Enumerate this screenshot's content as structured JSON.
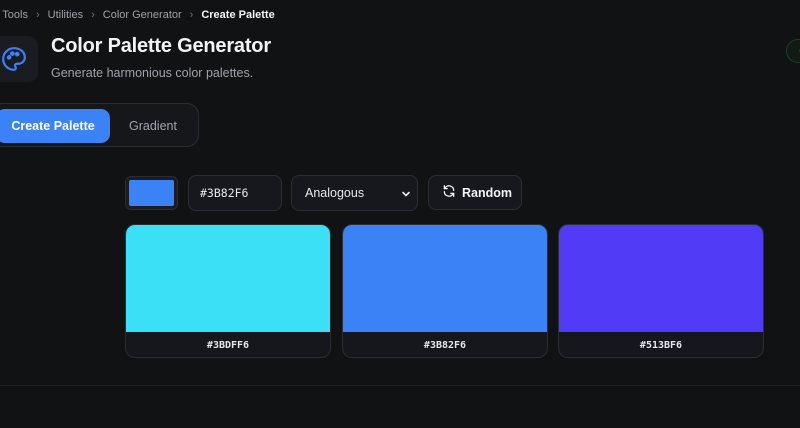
{
  "breadcrumb": {
    "items": [
      "l Tools",
      "Utilities",
      "Color Generator"
    ],
    "current": "Create Palette"
  },
  "header": {
    "icon": "palette-icon",
    "title": "Color Palette Generator",
    "subtitle": "Generate harmonious color palettes."
  },
  "tabs": [
    {
      "label": "Create Palette",
      "active": true
    },
    {
      "label": "Gradient",
      "active": false
    }
  ],
  "controls": {
    "base_color": "#3B82F6",
    "hex_value": "#3B82F6",
    "scheme": "Analogous",
    "random_label": "Random",
    "random_icon": "refresh-icon"
  },
  "palette": [
    {
      "hex": "#3BDFF6",
      "color": "#3BDFF6"
    },
    {
      "hex": "#3B82F6",
      "color": "#3B82F6"
    },
    {
      "hex": "#513BF6",
      "color": "#513BF6"
    }
  ],
  "colors": {
    "background": "#111214",
    "accent": "#3b82f6",
    "badge_green": "#22c55e"
  }
}
